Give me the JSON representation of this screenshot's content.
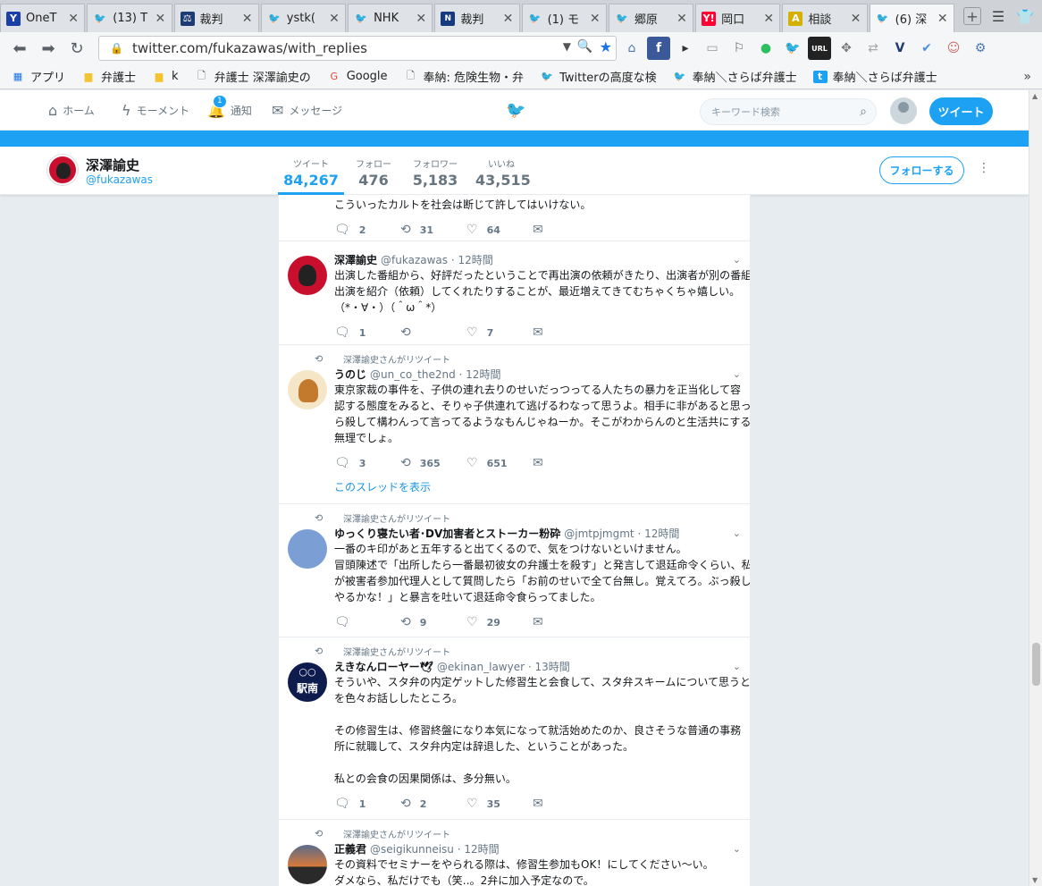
{
  "browser": {
    "tabs": [
      {
        "label": "OneT",
        "icon": "Y",
        "color": "#1a3fa8"
      },
      {
        "label": "(13) T",
        "icon": "twitter",
        "color": "#1da1f2"
      },
      {
        "label": "裁判",
        "icon": "court",
        "color": "#1f3b73"
      },
      {
        "label": "ystk(",
        "icon": "twitter",
        "color": "#1da1f2"
      },
      {
        "label": "NHK",
        "icon": "twitter",
        "color": "#1da1f2"
      },
      {
        "label": "裁判",
        "icon": "nhk",
        "color": "#163a80"
      },
      {
        "label": "(1) モ",
        "icon": "twitter",
        "color": "#1da1f2"
      },
      {
        "label": "郷原",
        "icon": "twitter",
        "color": "#1da1f2"
      },
      {
        "label": "岡口",
        "icon": "Y!",
        "color": "#ff0033"
      },
      {
        "label": "相談",
        "icon": "A",
        "color": "#d4b000"
      },
      {
        "label": "(6) 深",
        "icon": "twitter",
        "color": "#1da1f2",
        "active": true
      }
    ],
    "url": "twitter.com/fukazawas/with_replies",
    "bookmarks": [
      {
        "label": "アプリ",
        "icon": "apps-icon"
      },
      {
        "label": "弁護士",
        "icon": "folder-icon"
      },
      {
        "label": "k",
        "icon": "folder-icon"
      },
      {
        "label": "弁護士 深澤諭史の",
        "icon": "page-icon"
      },
      {
        "label": "Google",
        "icon": "google-icon"
      },
      {
        "label": "奉納: 危険生物・弁",
        "icon": "page-icon"
      },
      {
        "label": "Twitterの高度な検",
        "icon": "twitter-icon"
      },
      {
        "label": "奉納＼さらば弁護士",
        "icon": "twitter-icon"
      },
      {
        "label": "奉納＼さらば弁護士",
        "icon": "t-icon"
      }
    ]
  },
  "twitter": {
    "nav": {
      "home": "ホーム",
      "moments": "モーメント",
      "notifications": "通知",
      "notifications_badge": "1",
      "messages": "メッセージ",
      "search_placeholder": "キーワード検索",
      "tweet_button": "ツイート"
    },
    "profile": {
      "name": "深澤諭史",
      "handle": "@fukazawas",
      "stats": [
        {
          "label": "ツイート",
          "value": "84,267",
          "active": true
        },
        {
          "label": "フォロー",
          "value": "476"
        },
        {
          "label": "フォロワー",
          "value": "5,183"
        },
        {
          "label": "いいね",
          "value": "43,515"
        }
      ],
      "follow_button": "フォローする"
    },
    "tweets": [
      {
        "partial": true,
        "lines": [
          "こういったカルトを社会は断じて許してはいけない。"
        ],
        "replies": "2",
        "retweets": "31",
        "likes": "64"
      },
      {
        "name": "深澤諭史",
        "handle": "@fukazawas",
        "time": "· 12時間",
        "avatar": "godzilla",
        "lines": [
          "出演した番組から、好評だったということで再出演の依頼がきたり、出演者が別の番組",
          "出演を紹介（依頼）してくれたりすることが、最近増えてきてむちゃくちゃ嬉しい。",
          "（*・∀・）（＾ω＾*）"
        ],
        "replies": "1",
        "retweets": "",
        "likes": "7"
      },
      {
        "retweeted_by": "深澤諭史さんがリツイート",
        "name": "うのじ",
        "handle": "@un_co_the2nd",
        "time": "· 12時間",
        "avatar": "poop",
        "lines": [
          "東京家裁の事件を、子供の連れ去りのせいだっつってる人たちの暴力を正当化して容",
          "認する態度をみると、そりゃ子供連れて逃げるわなって思うよ。相手に非があると思った",
          "ら殺して構わんって言ってるようなもんじゃねーか。そこがわからんのと生活共にするの",
          "無理でしょ。"
        ],
        "replies": "3",
        "retweets": "365",
        "likes": "651",
        "thread_link": "このスレッドを表示"
      },
      {
        "retweeted_by": "深澤諭史さんがリツイート",
        "name": "ゆっくり寝たい者･DV加害者とストーカー粉砕",
        "handle": "@jmtpjmgmt",
        "time": "· 12時間",
        "avatar": "blue",
        "lines": [
          "一番のキ印があと五年すると出てくるので、気をつけないといけません。",
          "冒頭陳述で「出所したら一番最初彼女の弁護士を殺す」と発言して退廷命令くらい、私",
          "が被害者参加代理人として質問したら「お前のせいで全て台無し。覚えてろ。ぶっ殺して",
          "やるかな！」と暴言を吐いて退廷命令食らってました。"
        ],
        "replies": "",
        "retweets": "9",
        "likes": "29"
      },
      {
        "retweeted_by": "深澤諭史さんがリツイート",
        "name": "えきなんローヤー🕊",
        "handle": "@ekinan_lawyer",
        "time": "· 13時間",
        "avatar": "ekinan",
        "avatar_text": "駅南",
        "lines": [
          "そういや、スタ弁の内定ゲットした修習生と会食して、スタ弁スキームについて思うところ",
          "を色々お話ししたところ。",
          "",
          "その修習生は、修習終盤になり本気になって就活始めたのか、良さそうな普通の事務",
          "所に就職して、スタ弁内定は辞退した、ということがあった。",
          "",
          "私との会食の因果関係は、多分無い。"
        ],
        "replies": "1",
        "retweets": "2",
        "likes": "35"
      },
      {
        "retweeted_by": "深澤諭史さんがリツイート",
        "name": "正義君",
        "handle": "@seigikunneisu",
        "time": "· 12時間",
        "avatar": "sunset",
        "lines": [
          "その資料でセミナーをやられる際は、修習生参加もOK！にしてください〜い。",
          "ダメなら、私だけでも（笑‥。2弁に加入予定なので。"
        ],
        "replies": "",
        "retweets": "",
        "likes": ""
      }
    ]
  }
}
